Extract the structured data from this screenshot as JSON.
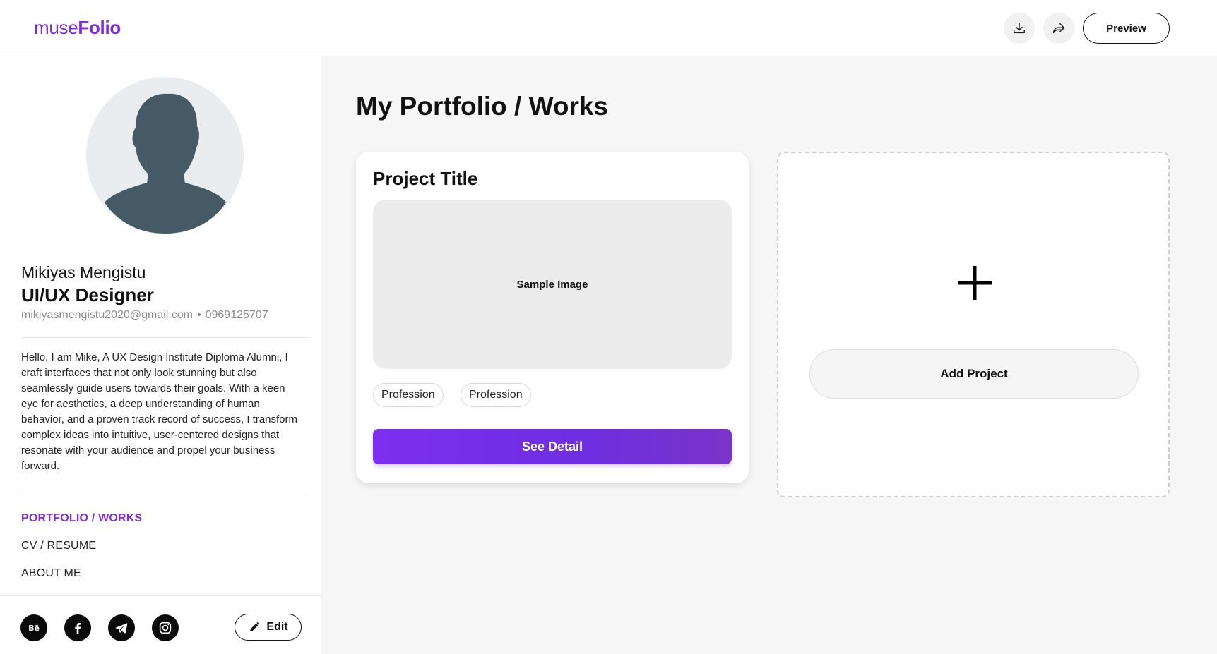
{
  "header": {
    "logo_light": "muse",
    "logo_bold": "Folio",
    "download_icon": "download-icon",
    "share_icon": "share-icon",
    "preview_label": "Preview"
  },
  "profile": {
    "name": "Mikiyas Mengistu",
    "role": "UI/UX Designer",
    "email": "mikiyasmengistu2020@gmail.com",
    "separator": "•",
    "phone": "0969125707",
    "bio": "Hello, I am Mike, A UX Design Institute Diploma Alumni, I craft interfaces that not only look stunning but also seamlessly guide users towards their goals. With a keen eye for aesthetics, a deep understanding of human behavior, and a proven track record of success, I transform complex ideas into intuitive, user-centered designs that resonate with your audience and propel your business forward."
  },
  "nav": {
    "items": [
      {
        "label": "PORTFOLIO / WORKS",
        "active": true
      },
      {
        "label": "CV / RESUME",
        "active": false
      },
      {
        "label": "ABOUT ME",
        "active": false
      }
    ]
  },
  "social": [
    "behance-icon",
    "facebook-icon",
    "telegram-icon",
    "instagram-icon"
  ],
  "edit_label": "Edit",
  "main": {
    "title": "My Portfolio / Works",
    "project_card": {
      "title": "Project Title",
      "image_label": "Sample Image",
      "tags": [
        "Profession",
        "Profession"
      ],
      "button_label": "See Detail"
    },
    "add_card": {
      "icon": "plus-icon",
      "button_label": "Add Project"
    }
  },
  "colors": {
    "accent": "#7b2ee0",
    "button_gradient_start": "#7c2ff0",
    "button_gradient_end": "#7a34c9",
    "avatar_bg": "#e9edf0",
    "avatar_figure": "#455a64"
  }
}
